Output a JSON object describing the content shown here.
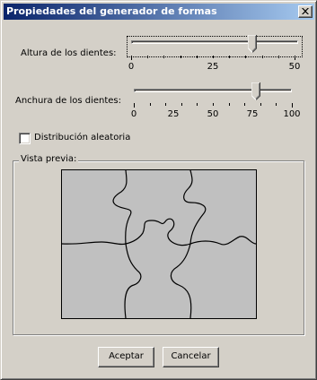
{
  "window": {
    "title": "Propiedades del generador de formas"
  },
  "height_slider": {
    "label": "Altura de los dientes:",
    "min": 0,
    "max": 50,
    "value": 37,
    "tick_step": 5,
    "tick_labels": [
      "0",
      "25",
      "50"
    ]
  },
  "width_slider": {
    "label": "Anchura de los dientes:",
    "min": 0,
    "max": 100,
    "value": 77,
    "tick_step": 10,
    "tick_labels": [
      "0",
      "25",
      "50",
      "75",
      "100"
    ]
  },
  "random_checkbox": {
    "label": "Distribución aleatoria",
    "checked": false
  },
  "preview_group": {
    "label": "Vista previa:"
  },
  "buttons": {
    "ok_label": "Aceptar",
    "cancel_label": "Cancelar"
  },
  "colors": {
    "face": "#d4d0c8",
    "preview_fill": "#c0c0c0",
    "title_start": "#0a246a",
    "title_end": "#a6caf0"
  }
}
